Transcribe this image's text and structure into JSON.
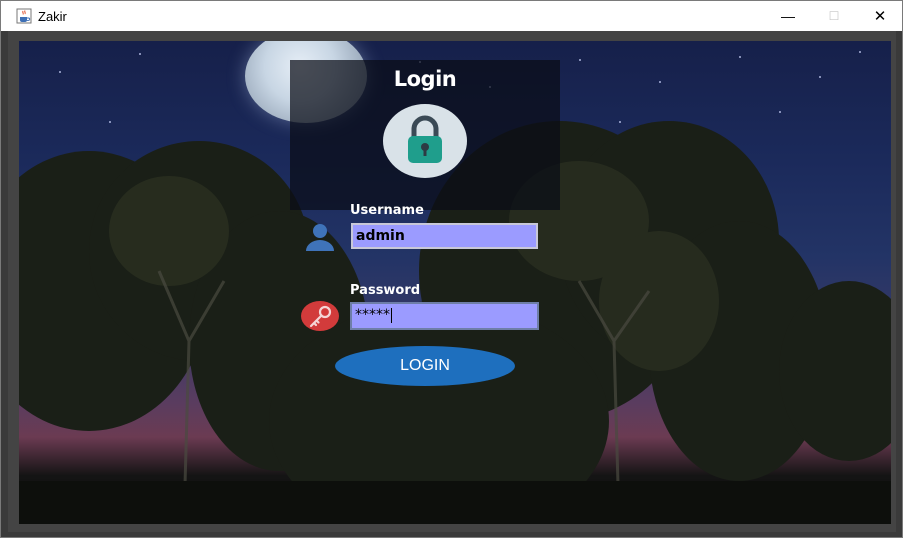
{
  "window": {
    "title": "Zakir",
    "minimize_glyph": "—",
    "maximize_glyph": "☐",
    "close_glyph": "✕"
  },
  "login": {
    "title": "Login",
    "username_label": "Username",
    "username_value": "admin",
    "password_label": "Password",
    "password_value": "*****",
    "button_label": "LOGIN"
  },
  "icons": {
    "app": "java-cup-icon",
    "lock": "padlock-icon",
    "user": "user-icon",
    "key": "key-icon"
  },
  "colors": {
    "field_bg": "#9b9bff",
    "button_bg": "#1e6fbe",
    "lock_teal": "#1f9e8c",
    "key_red": "#d23b3b",
    "user_blue": "#3f73b9"
  }
}
